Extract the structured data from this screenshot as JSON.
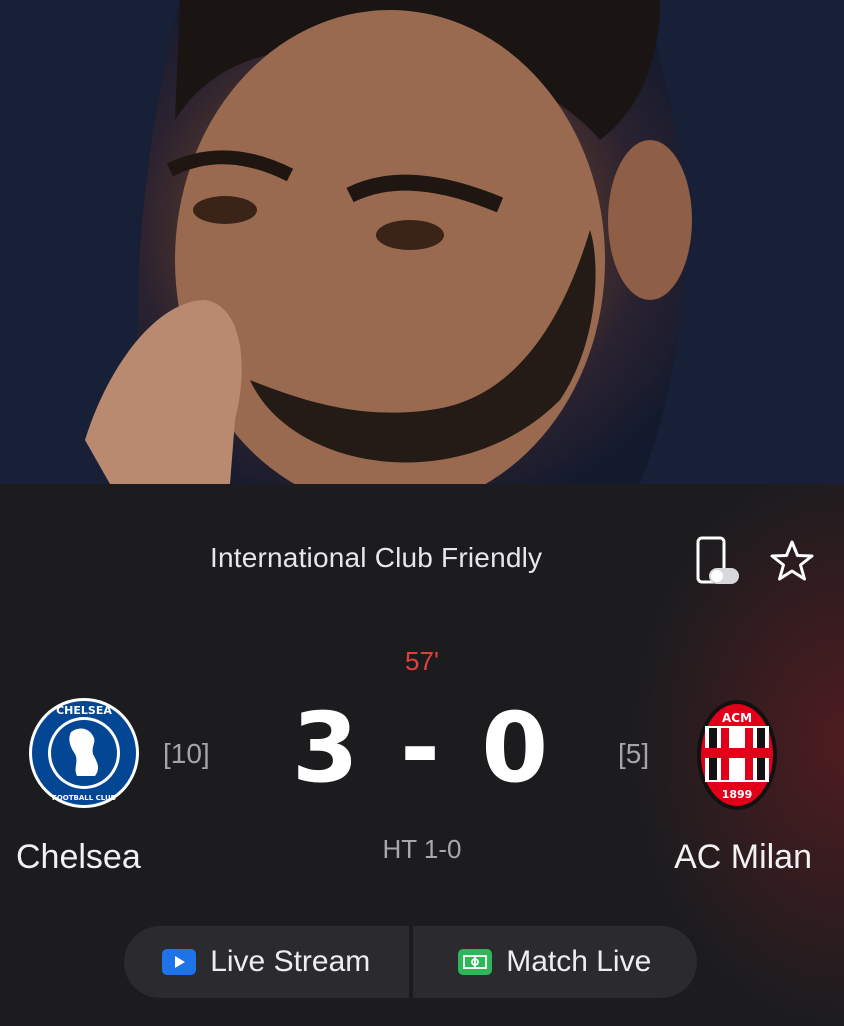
{
  "hero_image": {
    "description_icon": "coach-photo"
  },
  "match": {
    "competition": "International Club Friendly",
    "minute": "57'",
    "score": "3 - 0",
    "halftime": "HT 1-0",
    "home": {
      "name": "Chelsea",
      "rank": "[10]",
      "crest_text_top": "CHELSEA",
      "crest_text_bottom": "FOOTBALL CLUB",
      "color": "#034694"
    },
    "away": {
      "name": "AC Milan",
      "rank": "[5]",
      "crest_text_top": "ACM",
      "crest_year": "1899",
      "color": "#e1001a"
    }
  },
  "icons": {
    "phone": "phone-toggle-icon",
    "star": "star-icon"
  },
  "buttons": {
    "live_stream": {
      "label": "Live Stream",
      "icon": "play-icon",
      "color": "#1e73e8"
    },
    "match_live": {
      "label": "Match Live",
      "icon": "pitch-icon",
      "color": "#2fb55a"
    }
  }
}
